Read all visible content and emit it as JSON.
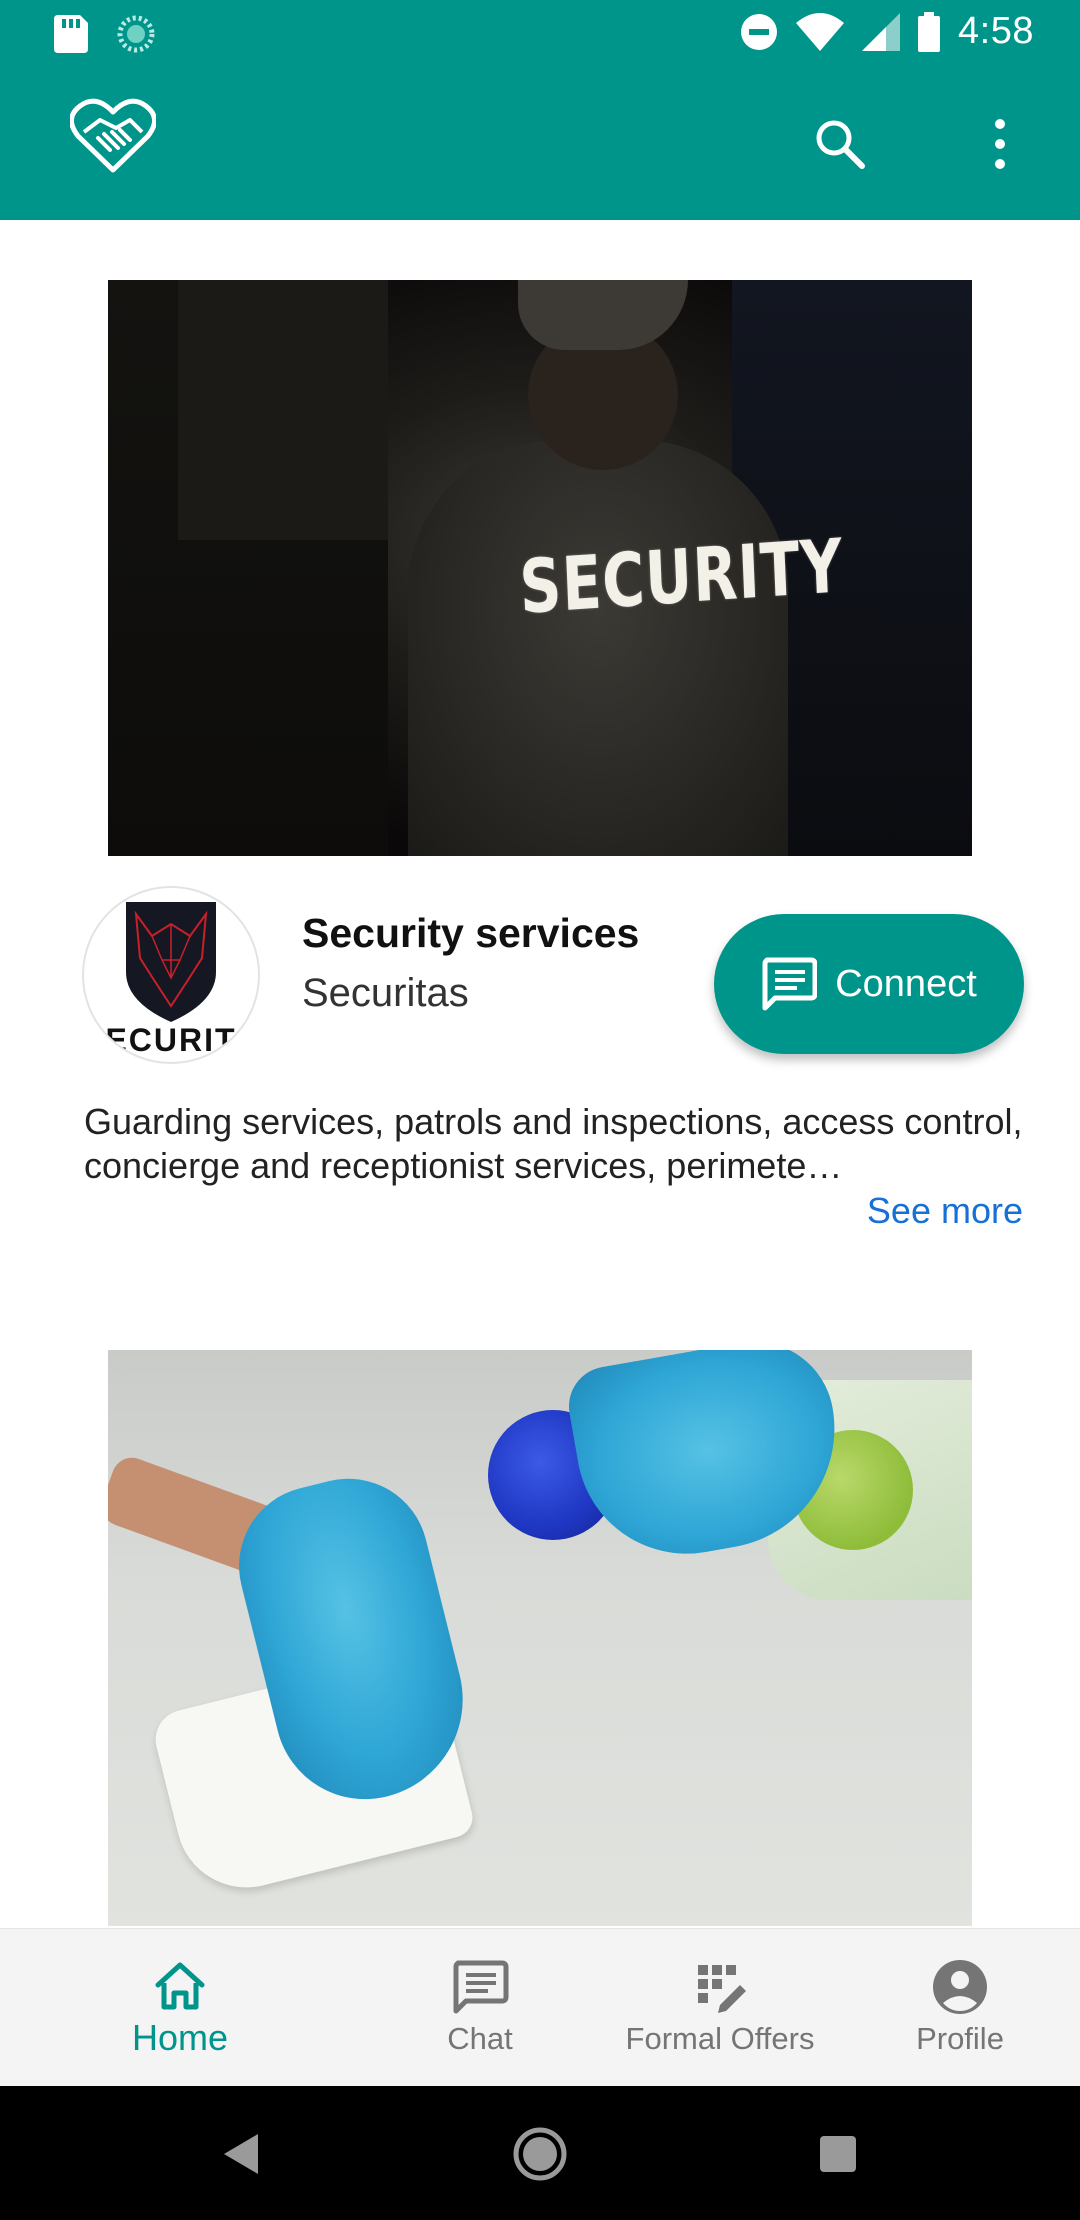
{
  "status_bar": {
    "time": "4:58",
    "left_icons": [
      "sd-card-icon",
      "sync-icon"
    ],
    "right_icons": [
      "do-not-disturb-icon",
      "wifi-icon",
      "signal-icon",
      "battery-icon"
    ]
  },
  "app_bar": {
    "logo_icon": "handshake-heart-icon",
    "actions": [
      "search-icon",
      "more-vert-icon"
    ]
  },
  "cards": [
    {
      "image": "security-guard-photo",
      "image_text": "SECURITY",
      "logo_text": "ECURIT",
      "title": "Security services",
      "company": "Securitas",
      "connect_label": "Connect",
      "description": "Guarding services, patrols and inspections, access control, concierge and receptionist services, perimete…",
      "see_more": "See more"
    },
    {
      "image": "cleaning-photo"
    }
  ],
  "bottom_nav": {
    "items": [
      {
        "label": "Home",
        "icon": "home-icon",
        "active": true
      },
      {
        "label": "Chat",
        "icon": "chat-icon",
        "active": false
      },
      {
        "label": "Formal Offers",
        "icon": "offers-icon",
        "active": false
      },
      {
        "label": "Profile",
        "icon": "profile-icon",
        "active": false
      }
    ]
  },
  "colors": {
    "primary": "#00958a",
    "link": "#1670d6",
    "nav_inactive": "#757575"
  }
}
